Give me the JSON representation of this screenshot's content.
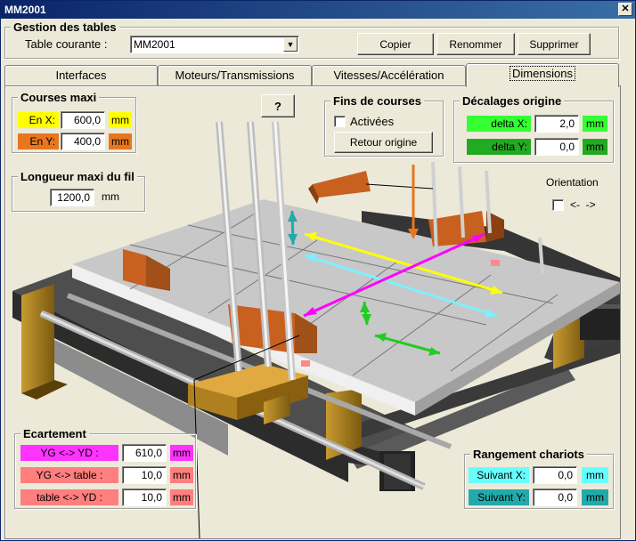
{
  "window": {
    "title": "MM2001",
    "close_glyph": "✕"
  },
  "tables_group": {
    "title": "Gestion des tables",
    "current_label": "Table courante :",
    "current_value": "MM2001",
    "copy_label": "Copier",
    "rename_label": "Renommer",
    "delete_label": "Supprimer"
  },
  "tabs": [
    {
      "label": "Interfaces"
    },
    {
      "label": "Moteurs/Transmissions"
    },
    {
      "label": "Vitesses/Accélération"
    },
    {
      "label": "Dimensions"
    }
  ],
  "help_label": "?",
  "courses": {
    "title": "Courses maxi",
    "x_label": "En X:",
    "x_value": "600,0",
    "x_unit": "mm",
    "y_label": "En Y:",
    "y_value": "400,0",
    "y_unit": "mm"
  },
  "wire": {
    "title": "Longueur maxi du fil",
    "value": "1200,0",
    "unit": "mm"
  },
  "limits": {
    "title": "Fins de courses",
    "enabled_label": "Activées",
    "return_label": "Retour origine"
  },
  "offsets": {
    "title": "Décalages origine",
    "dx_label": "delta X:",
    "dx_value": "2,0",
    "dx_unit": "mm",
    "dy_label": "delta Y:",
    "dy_value": "0,0",
    "dy_unit": "mm"
  },
  "orientation": {
    "title": "Orientation",
    "arrows": "<-  ->"
  },
  "spacing": {
    "title": "Ecartement",
    "yg_yd_label": "YG <-> YD :",
    "yg_yd_value": "610,0",
    "yg_yd_unit": "mm",
    "yg_table_label": "YG <-> table :",
    "yg_table_value": "10,0",
    "yg_table_unit": "mm",
    "table_yd_label": "table <-> YD :",
    "table_yd_value": "10,0",
    "table_yd_unit": "mm"
  },
  "parking": {
    "title": "Rangement chariots",
    "x_label": "Suivant X:",
    "x_value": "0,0",
    "x_unit": "mm",
    "y_label": "Suivant Y:",
    "y_value": "0,0",
    "y_unit": "mm"
  },
  "colors": {
    "courses_x": "#FFFF00",
    "courses_y": "#E8761E",
    "delta_x": "#33FF33",
    "delta_y": "#22AA22",
    "yg_yd": "#FF33FF",
    "spacing": "#FF7F7F",
    "parking_x": "#66FFFF",
    "parking_y": "#22AAAA"
  }
}
